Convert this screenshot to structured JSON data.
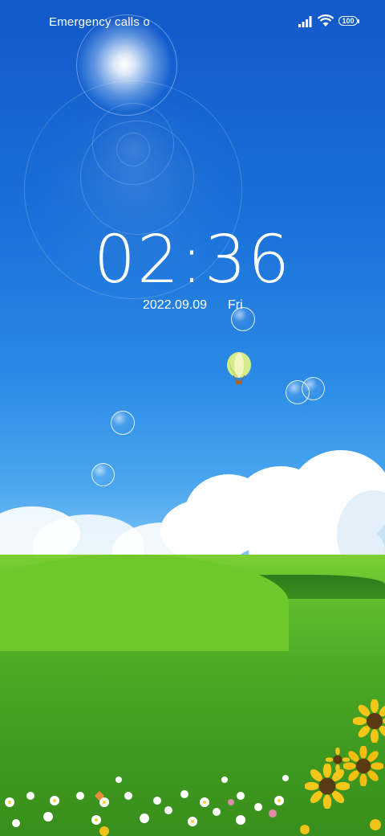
{
  "status_bar": {
    "carrier_text": "Emergency calls o",
    "battery_level": "100",
    "signal_icon": "signal-icon",
    "wifi_icon": "wifi-icon",
    "battery_icon": "battery-icon"
  },
  "lockscreen": {
    "time": "02:36",
    "date": "2022.09.09",
    "weekday": "Fri"
  },
  "wallpaper": {
    "description_icons": [
      "sun-flare",
      "balloon-icon",
      "bubble",
      "sunflower"
    ],
    "sky_color": "#1a6fd8",
    "grass_color": "#4aa624"
  }
}
